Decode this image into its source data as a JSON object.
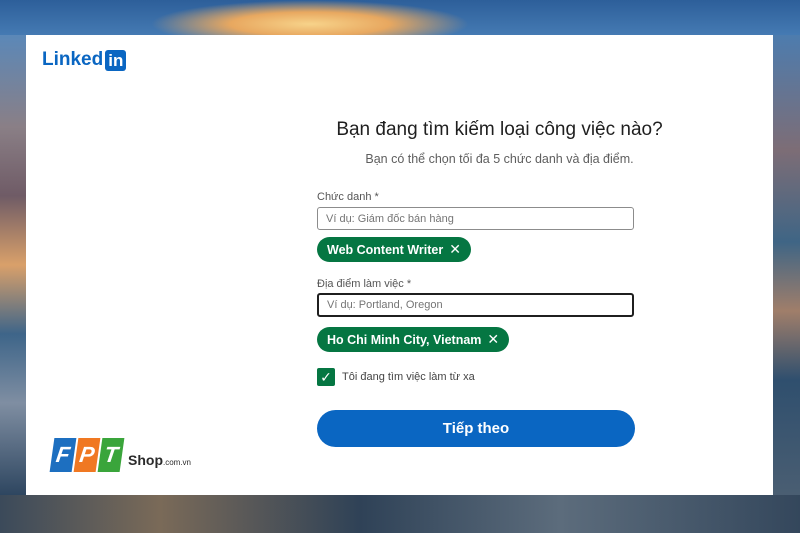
{
  "brand": {
    "logo_text": "Linked",
    "logo_in": "in"
  },
  "form": {
    "title": "Bạn đang tìm kiếm loại công việc nào?",
    "subtitle": "Bạn có thể chọn tối đa 5 chức danh và địa điểm.",
    "job_title": {
      "label": "Chức danh *",
      "placeholder": "Ví dụ: Giám đốc bán hàng",
      "value": "",
      "selected": [
        "Web Content Writer"
      ]
    },
    "location": {
      "label": "Địa điểm làm việc *",
      "placeholder": "Ví dụ: Portland, Oregon",
      "value": "",
      "selected": [
        "Ho Chi Minh City, Vietnam"
      ]
    },
    "remote": {
      "label": "Tôi đang tìm việc làm từ xa",
      "checked": true
    },
    "next_button": "Tiếp theo",
    "remove_icon": "close-icon"
  },
  "watermark": {
    "f": "F",
    "p": "P",
    "t": "T",
    "shop": "Shop",
    "domain": ".com.vn",
    "colors": [
      "#1d6fc0",
      "#f07822",
      "#3aa53b"
    ]
  },
  "colors": {
    "linkedin_blue": "#0a66c2",
    "green": "#057642"
  }
}
